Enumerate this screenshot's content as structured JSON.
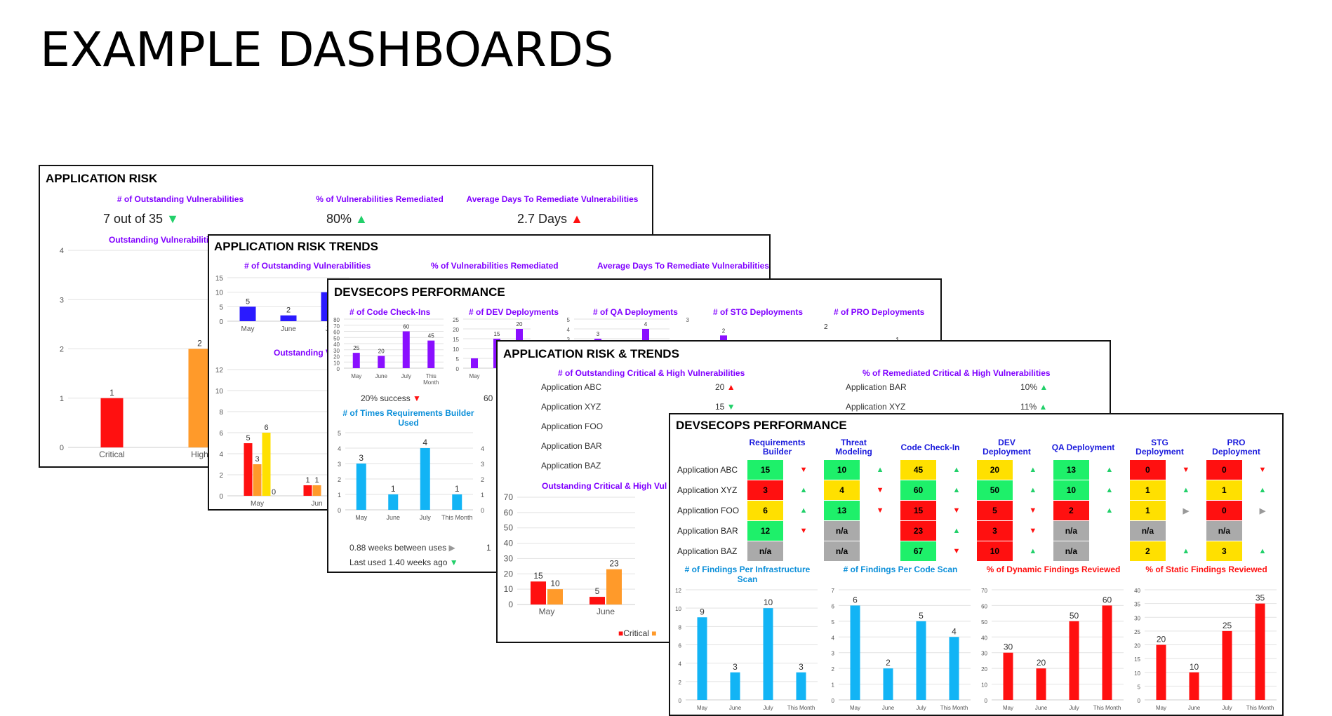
{
  "slide_title": "EXAMPLE DASHBOARDS",
  "p1": {
    "title": "APPLICATION RISK",
    "metrics": [
      {
        "label": "# of Outstanding Vulnerabilities",
        "value": "7 out of 35",
        "arrow": "▼"
      },
      {
        "label": "% of Vulnerabilities Remediated",
        "value": "80%",
        "arrow": "▲"
      },
      {
        "label": "Average Days To Remediate Vulnerabilities",
        "value": "2.7 Days",
        "arrow": "▲"
      }
    ],
    "chart_title": "Outstanding Vulnerabiliti",
    "chart_data": {
      "type": "bar",
      "categories": [
        "Critical",
        "High"
      ],
      "values": [
        1,
        2
      ],
      "ylim": [
        0,
        4
      ],
      "yticks": [
        "0",
        "1",
        "2",
        "3",
        "4"
      ],
      "colors": [
        "#ff1010",
        "#ff9a2a"
      ]
    }
  },
  "p2": {
    "title": "APPLICATION RISK TRENDS",
    "metrics": [
      "# of Outstanding Vulnerabilities",
      "% of Vulnerabilities Remediated",
      "Average Days To Remediate Vulnerabilities"
    ],
    "top_chart": {
      "type": "bar",
      "categories": [
        "May",
        "June",
        "Ju"
      ],
      "values": [
        5,
        2,
        10
      ],
      "labels": [
        "5",
        "2",
        ""
      ],
      "yticks": [
        "0",
        "5",
        "10",
        "15"
      ],
      "ylim": [
        0,
        15
      ],
      "color": "#2a1aff"
    },
    "sub_title": "Outstanding V",
    "bottom_chart": {
      "type": "bar",
      "categories": [
        "May",
        "Jun"
      ],
      "series": [
        {
          "values": [
            5,
            1
          ]
        },
        {
          "values": [
            3,
            1
          ]
        },
        {
          "values": [
            6,
            0
          ]
        }
      ],
      "yticks": [
        "0",
        "2",
        "4",
        "6",
        "8",
        "10",
        "12"
      ],
      "ylim": [
        0,
        12
      ],
      "colors": [
        "#ff1010",
        "#ff9a2a",
        "#ffe000"
      ]
    }
  },
  "p3": {
    "title": "DEVSECOPS PERFORMANCE",
    "metrics": [
      "# of Code Check-Ins",
      "# of DEV Deployments",
      "# of QA Deployments",
      "# of STG Deployments",
      "# of PRO Deployments"
    ],
    "checkins": {
      "type": "bar",
      "categories": [
        "May",
        "June",
        "July",
        "This Month"
      ],
      "values": [
        25,
        20,
        60,
        45
      ],
      "yticks": [
        "0",
        "10",
        "20",
        "30",
        "40",
        "50",
        "60",
        "70",
        "80"
      ],
      "ylim": [
        0,
        80
      ],
      "color": "#8a0fff"
    },
    "dev": {
      "type": "bar",
      "categories": [
        "May"
      ],
      "values": [
        5,
        15,
        20
      ],
      "labels": [
        "",
        "15",
        "20"
      ],
      "yticks": [
        "0",
        "5",
        "10",
        "15",
        "20",
        "25"
      ],
      "ylim": [
        0,
        25
      ],
      "color": "#8a0fff"
    },
    "qa": {
      "type": "bar",
      "values": [
        3,
        4
      ],
      "labels": [
        "3",
        "4"
      ],
      "yticks": [
        "0",
        "1",
        "2",
        "3",
        "4",
        "5"
      ],
      "ylim": [
        0,
        5
      ],
      "color": "#8a0fff"
    },
    "stg": {
      "type": "bar",
      "values": [
        2
      ],
      "labels": [
        "2"
      ],
      "yticks": [
        "3"
      ],
      "ylim": [
        0,
        3
      ],
      "color": "#8a0fff"
    },
    "pro": {
      "yticks": [
        "2"
      ],
      "labels": [
        "1"
      ]
    },
    "success_text": "20% success",
    "success_tail": "60",
    "req_title_1": "# of Times Requirements Builder",
    "req_title_2": "Used",
    "req_chart": {
      "type": "bar",
      "categories": [
        "May",
        "June",
        "July",
        "This Month"
      ],
      "values": [
        3,
        1,
        4,
        1
      ],
      "yticks": [
        "0",
        "1",
        "2",
        "3",
        "4",
        "5"
      ],
      "ylim": [
        0,
        5
      ],
      "color": "#12b4f5"
    },
    "right_ticks": [
      "0",
      "1",
      "2",
      "3",
      "4"
    ],
    "weeks_text": "0.88 weeks between uses",
    "last_used_text": "Last used 1.40 weeks ago",
    "tail_1": "1"
  },
  "p4": {
    "title": "APPLICATION RISK & TRENDS",
    "metric_left": "# of Outstanding Critical & High Vulnerabilities",
    "metric_right": "% of Remediated Critical & High Vulnerabilities",
    "apps_left": [
      {
        "name": "Application ABC",
        "value": "20",
        "arrow": "▲"
      },
      {
        "name": "Application XYZ",
        "value": "15",
        "arrow": "▼"
      },
      {
        "name": "Application FOO",
        "value": "",
        "arrow": ""
      },
      {
        "name": "Application BAR",
        "value": "",
        "arrow": ""
      },
      {
        "name": "Application BAZ",
        "value": "",
        "arrow": ""
      }
    ],
    "apps_right": [
      {
        "name": "Application BAR",
        "value": "10%",
        "arrow": "▲"
      },
      {
        "name": "Application XYZ",
        "value": "11%",
        "arrow": "▲"
      }
    ],
    "chart_title": "Outstanding Critical & High Vul",
    "chart": {
      "type": "bar",
      "categories": [
        "May",
        "June"
      ],
      "series": [
        {
          "name": "Critical",
          "values": [
            15,
            5
          ]
        },
        {
          "name": "",
          "values": [
            10,
            23
          ]
        }
      ],
      "yticks": [
        "0",
        "10",
        "20",
        "30",
        "40",
        "50",
        "60",
        "70"
      ],
      "ylim": [
        0,
        70
      ],
      "colors": [
        "#ff1010",
        "#ff9a2a"
      ]
    },
    "legend_critical": "Critical"
  },
  "p5": {
    "title": "DEVSECOPS PERFORMANCE",
    "columns": [
      [
        "Requirements",
        "Builder"
      ],
      [
        "Threat",
        "Modeling"
      ],
      [
        "Code Check-In",
        ""
      ],
      [
        "DEV",
        "Deployment"
      ],
      [
        "QA Deployment",
        ""
      ],
      [
        "STG",
        "Deployment"
      ],
      [
        "PRO",
        "Deployment"
      ]
    ],
    "rows": [
      {
        "app": "Application ABC",
        "cells": [
          [
            "15",
            "#1ef06a",
            "▼"
          ],
          [
            "10",
            "#1ef06a",
            "▲"
          ],
          [
            "45",
            "#ffe000",
            "▲"
          ],
          [
            "20",
            "#ffe000",
            "▲"
          ],
          [
            "13",
            "#1ef06a",
            "▲"
          ],
          [
            "0",
            "#ff1010",
            "▼"
          ],
          [
            "0",
            "#ff1010",
            "▼"
          ]
        ]
      },
      {
        "app": "Application XYZ",
        "cells": [
          [
            "3",
            "#ff1010",
            "▲"
          ],
          [
            "4",
            "#ffe000",
            "▼"
          ],
          [
            "60",
            "#1ef06a",
            "▲"
          ],
          [
            "50",
            "#1ef06a",
            "▲"
          ],
          [
            "10",
            "#1ef06a",
            "▲"
          ],
          [
            "1",
            "#ffe000",
            "▲"
          ],
          [
            "1",
            "#ffe000",
            "▲"
          ]
        ]
      },
      {
        "app": "Application FOO",
        "cells": [
          [
            "6",
            "#ffe000",
            "▲"
          ],
          [
            "13",
            "#1ef06a",
            "▼"
          ],
          [
            "15",
            "#ff1010",
            "▼"
          ],
          [
            "5",
            "#ff1010",
            "▼"
          ],
          [
            "2",
            "#ff1010",
            "▲"
          ],
          [
            "1",
            "#ffe000",
            "▶"
          ],
          [
            "0",
            "#ff1010",
            "▶"
          ]
        ]
      },
      {
        "app": "Application BAR",
        "cells": [
          [
            "12",
            "#1ef06a",
            "▼"
          ],
          [
            "n/a",
            "#aaaaaa",
            ""
          ],
          [
            "23",
            "#ff1010",
            "▲"
          ],
          [
            "3",
            "#ff1010",
            "▼"
          ],
          [
            "n/a",
            "#aaaaaa",
            ""
          ],
          [
            "n/a",
            "#aaaaaa",
            ""
          ],
          [
            "n/a",
            "#aaaaaa",
            ""
          ]
        ]
      },
      {
        "app": "Application BAZ",
        "cells": [
          [
            "n/a",
            "#aaaaaa",
            ""
          ],
          [
            "n/a",
            "#aaaaaa",
            ""
          ],
          [
            "67",
            "#1ef06a",
            "▼"
          ],
          [
            "10",
            "#ff1010",
            "▲"
          ],
          [
            "n/a",
            "#aaaaaa",
            ""
          ],
          [
            "2",
            "#ffe000",
            "▲"
          ],
          [
            "3",
            "#ffe000",
            "▲"
          ]
        ]
      }
    ],
    "charts": [
      {
        "title": [
          "# of Findings Per Infrastructure",
          "Scan"
        ],
        "color_class": "blue",
        "color": "#12b4f5",
        "categories": [
          "May",
          "June",
          "July",
          "This Month"
        ],
        "values": [
          9,
          3,
          10,
          3
        ],
        "yticks": [
          "0",
          "2",
          "4",
          "6",
          "8",
          "10",
          "12"
        ],
        "ylim": [
          0,
          12
        ]
      },
      {
        "title": [
          "# of Findings Per Code Scan",
          ""
        ],
        "color_class": "blue",
        "color": "#12b4f5",
        "categories": [
          "May",
          "June",
          "July",
          "This Month"
        ],
        "values": [
          6,
          2,
          5,
          4
        ],
        "yticks": [
          "0",
          "1",
          "2",
          "3",
          "4",
          "5",
          "6",
          "7"
        ],
        "ylim": [
          0,
          7
        ]
      },
      {
        "title": [
          "% of Dynamic Findings Reviewed",
          ""
        ],
        "color_class": "red",
        "color": "#ff1010",
        "categories": [
          "May",
          "June",
          "July",
          "This Month"
        ],
        "values": [
          30,
          20,
          50,
          60
        ],
        "yticks": [
          "0",
          "10",
          "20",
          "30",
          "40",
          "50",
          "60",
          "70"
        ],
        "ylim": [
          0,
          70
        ]
      },
      {
        "title": [
          "% of Static Findings Reviewed",
          ""
        ],
        "color_class": "red",
        "color": "#ff1010",
        "categories": [
          "May",
          "June",
          "July",
          "This Month"
        ],
        "values": [
          20,
          10,
          25,
          35
        ],
        "yticks": [
          "0",
          "5",
          "10",
          "15",
          "20",
          "25",
          "30",
          "35",
          "40"
        ],
        "ylim": [
          0,
          40
        ]
      }
    ]
  }
}
